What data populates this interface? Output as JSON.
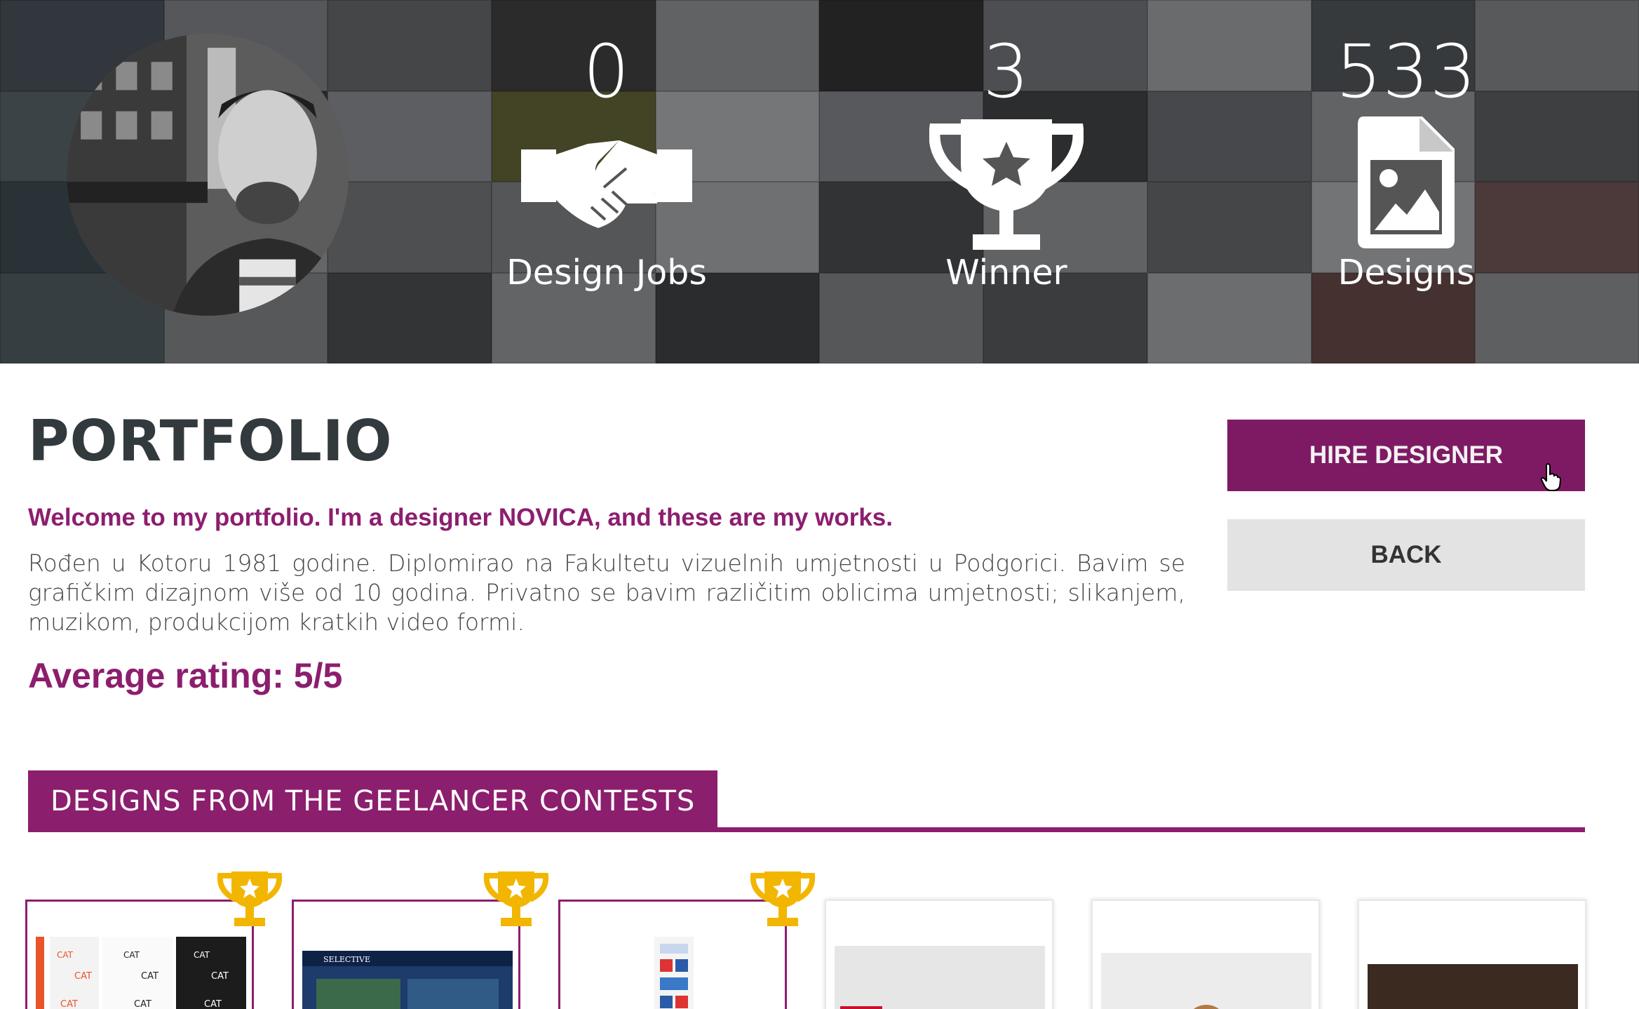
{
  "hero": {
    "stats": [
      {
        "value": "0",
        "label": "Design Jobs",
        "icon": "handshake-icon"
      },
      {
        "value": "3",
        "label": "Winner",
        "icon": "trophy-icon"
      },
      {
        "value": "533",
        "label": "Designs",
        "icon": "image-file-icon"
      }
    ]
  },
  "portfolio": {
    "title": "PORTFOLIO",
    "welcome": "Welcome to my portfolio. I'm a designer NOVICA, and these are my works.",
    "bio": "Rođen u Kotoru 1981 godine. Diplomirao na Fakultetu vizuelnih umjetnosti u Podgorici. Bavim se grafičkim dizajnom više od 10 godina. Privatno se bavim različitim oblicima umjetnosti; slikanjem, muzikom, produkcijom kratkih video formi.",
    "rating": "Average rating: 5/5"
  },
  "actions": {
    "hire_label": "HIRE DESIGNER",
    "back_label": "BACK"
  },
  "section": {
    "title": "DESIGNS FROM THE GEELANCER CONTESTS"
  },
  "designs": [
    {
      "winner": true,
      "thumb_text": "CAT"
    },
    {
      "winner": true,
      "thumb_text": "SELECTIVE"
    },
    {
      "winner": true,
      "thumb_text": ""
    },
    {
      "winner": false,
      "thumb_text": ""
    },
    {
      "winner": false,
      "thumb_text": ""
    },
    {
      "winner": false,
      "thumb_text": ""
    }
  ],
  "colors": {
    "brand": "#8c1e6e",
    "button_hire": "#7e1a63",
    "button_back": "#e3e3e3",
    "trophy": "#f2b600"
  }
}
